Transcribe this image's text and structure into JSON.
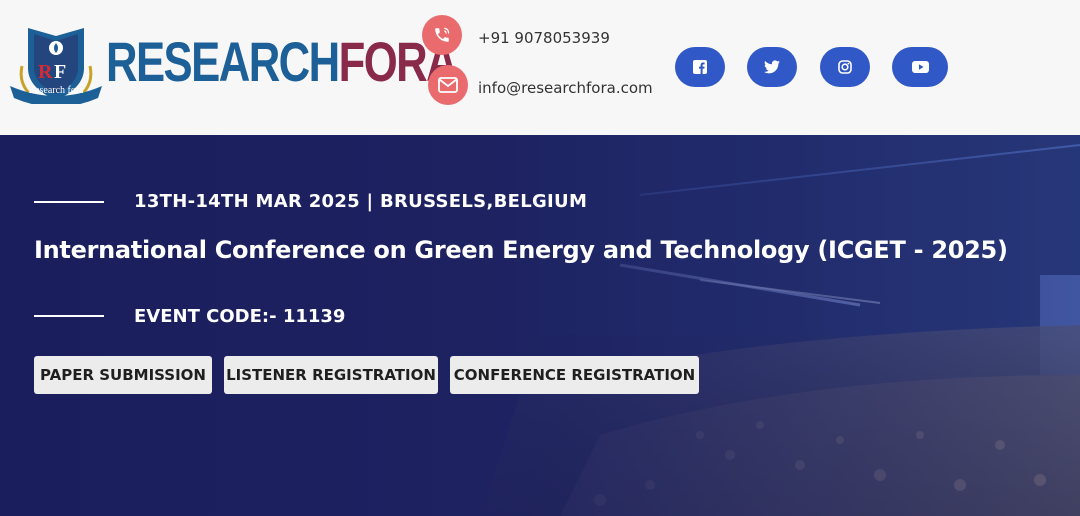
{
  "header": {
    "logo": {
      "brand_part1": "RESEARCH",
      "brand_part2": "FORA",
      "emblem_text": "Research fora",
      "colors": {
        "research": "#1d5f97",
        "fora": "#8a2a4a"
      }
    },
    "contact": {
      "phone": "+91 9078053939",
      "email": "info@researchfora.com",
      "icon_color": "#e96b6e"
    },
    "social": {
      "items": [
        {
          "name": "facebook-icon"
        },
        {
          "name": "twitter-icon"
        },
        {
          "name": "instagram-icon"
        },
        {
          "name": "youtube-icon"
        }
      ],
      "color": "#3158c7"
    }
  },
  "hero": {
    "date_location": "13TH-14TH MAR 2025 | BRUSSELS,BELGIUM",
    "title": "International Conference on Green Energy and Technology (ICGET - 2025)",
    "event_code": "EVENT CODE:- 11139",
    "buttons": {
      "paper_submission": "PAPER SUBMISSION",
      "listener_registration": "LISTENER REGISTRATION",
      "conference_registration": "CONFERENCE REGISTRATION"
    }
  }
}
